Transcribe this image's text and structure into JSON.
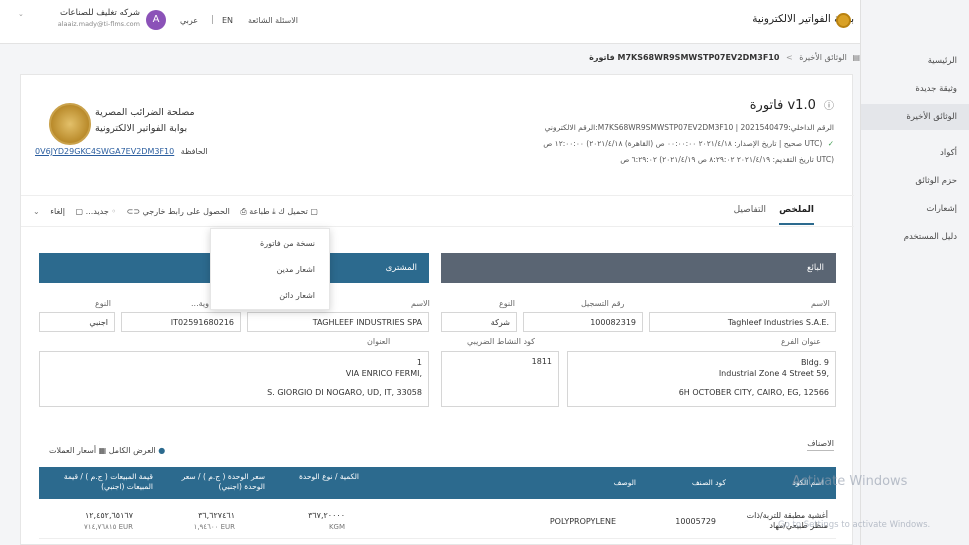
{
  "header": {
    "org_name": "شركه تغليف للصناعات",
    "org_email": "alaaiz.mady@ti-flms.com",
    "avatar_letter": "A",
    "lang_ar": "عربي",
    "lang_sep": "|",
    "lang_en": "EN",
    "faq": "الاسئلة الشائعة",
    "portal_title": "بوابة الفواتير الالكترونية"
  },
  "breadcrumb": {
    "root": "الوثائق الأخيرة",
    "sep": "<",
    "current": "فاتورة M7KS68WR9SMWSTP07EV2DM3F10"
  },
  "sidebar": {
    "items": [
      "الرئيسية",
      "وثيقة جديدة",
      "الوثائق الأخيرة",
      "أكواد",
      "حزم الوثائق",
      "إشعارات",
      "دليل المستخدم"
    ]
  },
  "doc": {
    "title": "فاتورة v1.0",
    "id_line": "الرقم الالكتروني:M7KS68WR9SMWSTP07EV2DM3F10 | الرقم الداخلي:2021540479",
    "status_line": "صحيح | تاريخ الإصدار: ٢٠٢١/٤/١٨ ٠٠:٠٠:٠٠ ص (القاهرة) ٢٠٢١/٤/١٨) ١٢:٠٠:٠٠ ص UTC)",
    "submit_line": "تاريخ التقديم: ٢٠٢١/٤/١٩ ٨:٢٩:٠٢ ص ٢٠٢١/٤/١٩) ٦:٢٩:٠٢ ص UTC)",
    "authority_1": "مصلحة الضرائب المصرية",
    "authority_2": "بوابة الفواتير الالكترونية",
    "wallet_code": "0V6JYD29GKC4SWGA7EV2DM3F10",
    "wallet_label": "الحافظة"
  },
  "tabs": {
    "summary": "الملخص",
    "details": "التفاصيل"
  },
  "actions": {
    "cancel": "إلغاء",
    "new": "جديد...",
    "external_link": "الحصول على رابط خارجي",
    "print": "طباعة",
    "download": "تحميل ك"
  },
  "new_menu": {
    "items": [
      "نسخة من فاتورة",
      "اشعار مدين",
      "اشعار دائن"
    ]
  },
  "seller": {
    "header": "البائع",
    "name_label": "الاسم",
    "name": "Taghleef Industries S.A.E.",
    "reg_label": "رقم التسجيل",
    "reg": "100082319",
    "type_label": "النوع",
    "type": "شركة",
    "branch_label": "عنوان الفرع",
    "activity_label": "كود النشاط الضريبي",
    "activity": "1811",
    "addr1": "Bldg. 9",
    "addr2": "Industrial Zone 4 Street 59,",
    "addr3": "6H OCTOBER CITY, CAIRO, EG, 12566"
  },
  "buyer": {
    "header": "المشترى",
    "name_label": "الاسم",
    "name": "TAGHLEEF INDUSTRIES SPA",
    "id_label": "...وية",
    "id": "IT02591680216",
    "type_label": "النوع",
    "type": "اجنبي",
    "address_label": "العنوان",
    "addr1": "1",
    "addr2": "VIA ENRICO FERMI,",
    "addr3": "S. GIORGIO DI NOGARO, UD, IT, 33058"
  },
  "items": {
    "section_label": "الاصناف",
    "rates_label": "أسعار العملات",
    "full_view": "العرض الكامل",
    "columns": [
      "اسم الكود",
      "كود الصنف",
      "الوصف",
      "الكمية / نوع الوحدة",
      "سعر الوحدة ( ج.م ) / سعر الوحدة (اجنبي)",
      "قيمة المبيعات ( ج.م ) / قيمة المبيعات (اجنبي)"
    ],
    "row": {
      "code_name": "أغشية مطبقة للتربة/ذات منظر طبيعي/مهاد",
      "item_code": "10005729",
      "description": "POLYPROPYLENE",
      "qty": "٣٦٧,٢٠٠٠٠",
      "unit": "KGM",
      "unit_price": "٣٦,٦٢٧٤٦١",
      "unit_price_foreign": "١,٩٤٦٠٠ EUR",
      "sales": "١٢,٤٥٢,٦٥١٦٧",
      "sales_foreign": "٧١٤,٧٦٨١٥ EUR"
    }
  },
  "watermark": {
    "line1": "Activate Windows",
    "line2": "Go to Settings to activate Windows."
  }
}
